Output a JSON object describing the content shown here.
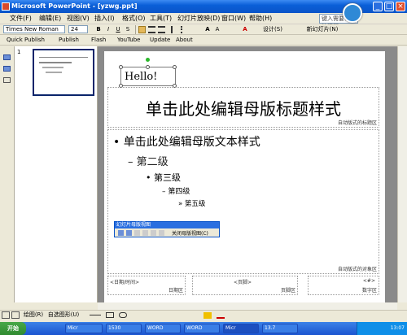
{
  "titlebar": {
    "title": "Microsoft PowerPoint - [yzwg.ppt]",
    "min": "_",
    "max": "□",
    "close": "×"
  },
  "menubar": {
    "items": [
      "文件(F)",
      "编辑(E)",
      "视图(V)",
      "插入(I)",
      "格式(O)",
      "工具(T)",
      "幻灯片放映(D)",
      "窗口(W)",
      "帮助(H)"
    ],
    "help_placeholder": "键入需要帮助的问题"
  },
  "toolbar1": {
    "font_name": "Times New Roman",
    "font_size": "24",
    "bold": "B",
    "italic": "I",
    "underline": "U",
    "shadow": "S",
    "design": "设计(S)",
    "new_slide": "新幻灯片(N)"
  },
  "toolbar2": {
    "items": [
      "Quick Publish",
      "Publish",
      "Flash",
      "YouTube",
      "Update",
      "About"
    ]
  },
  "thumbnails": {
    "slide_number": "1"
  },
  "slide": {
    "hello_text": "Hello!",
    "title_placeholder": "单击此处编辑母版标题样式",
    "title_area_label": "自动版式的标题区",
    "body_levels": [
      "单击此处编辑母版文本样式",
      "第二级",
      "第三级",
      "第四级",
      "第五级"
    ],
    "body_area_label": "自动版式的对象区",
    "date_placeholder": "<日期/时间>",
    "date_label": "日期区",
    "footer_placeholder": "<页脚>",
    "footer_label": "页脚区",
    "number_placeholder": "<#>",
    "number_label": "数字区"
  },
  "floating_toolbar": {
    "title": "幻灯片母版视图",
    "close_master": "关闭母版视图(C)"
  },
  "drawbar": {
    "draw": "绘图(R)",
    "autoshapes": "自选图形(U)"
  },
  "taskbar": {
    "start": "开始",
    "tasks": [
      "Micr",
      "1530",
      "WORD",
      "WORD",
      "Micr",
      "13.7"
    ],
    "clock": "13:07"
  },
  "colors": {
    "title_blue": "#0a54c8",
    "selection": "#0a246a"
  }
}
